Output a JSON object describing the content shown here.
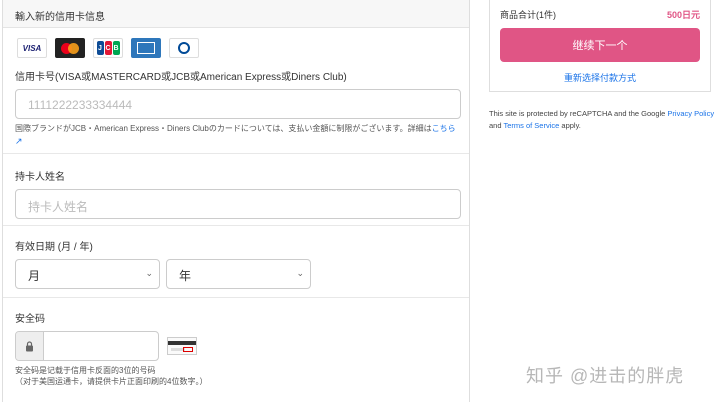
{
  "form": {
    "section_title": "輸入新的信用卡信息",
    "card_logos": [
      "VISA",
      "MasterCard",
      "JCB",
      "American Express",
      "Diners Club"
    ],
    "card_number": {
      "label": "信用卡号(VISA或MASTERCARD或JCB或American Express或Diners Club)",
      "placeholder": "1111222233334444",
      "note_text": "国際ブランドがJCB・American Express・Diners Clubのカードについては、支払い金額に制限がございます。詳細は",
      "note_link": "こちら"
    },
    "holder_name": {
      "label": "持卡人姓名",
      "placeholder": "持卡人姓名"
    },
    "expiry": {
      "label": "有效日期 (月 / 年)",
      "month_value": "月",
      "year_value": "年"
    },
    "security_code": {
      "label": "安全码",
      "note_line1": "安全码是记载于信用卡反面的3位的号码",
      "note_line2": "（对于美国运通卡，请提供卡片正面印刷的4位数字。）"
    }
  },
  "summary": {
    "total_label": "商品合计(1件)",
    "total_value": "500日元",
    "next_button": "继续下一个",
    "reselect_link": "重新选择付款方式"
  },
  "recaptcha": {
    "text1": "This site is protected by reCAPTCHA and the Google ",
    "privacy_link": "Privacy Policy",
    "text2": " and ",
    "terms_link": "Terms of Service",
    "text3": " apply."
  },
  "watermark": "知乎 @进击的胖虎",
  "colors": {
    "accent": "#e05585",
    "link": "#1a73e8"
  }
}
